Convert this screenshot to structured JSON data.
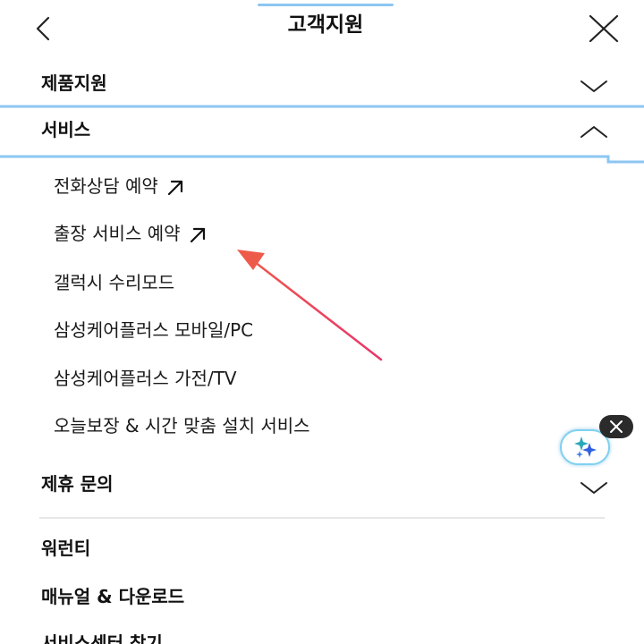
{
  "header": {
    "title": "고객지원",
    "back_icon": "back-chevron-icon",
    "close_icon": "close-icon"
  },
  "sections": [
    {
      "label": "제품지원",
      "state": "collapsed"
    },
    {
      "label": "서비스",
      "state": "expanded"
    },
    {
      "label": "제휴 문의",
      "state": "collapsed"
    }
  ],
  "service_items": [
    {
      "label": "전화상담 예약",
      "external": true
    },
    {
      "label": "출장 서비스 예약",
      "external": true
    },
    {
      "label": "갤럭시 수리모드",
      "external": false
    },
    {
      "label": "삼성케어플러스 모바일/PC",
      "external": false
    },
    {
      "label": "삼성케어플러스 가전/TV",
      "external": false
    },
    {
      "label": "오늘보장 & 시간 맞춤 설치 서비스",
      "external": false
    }
  ],
  "links": [
    {
      "label": "워런티"
    },
    {
      "label": "매뉴얼 & 다운로드"
    },
    {
      "label": "서비스센터 찾기"
    }
  ],
  "colors": {
    "accent_border": "#8cc6f2",
    "annotation_arrow": "#e8475f",
    "fab_ring": "#7fd1f0"
  },
  "floating_button": {
    "icon": "sparkle-icon",
    "dismiss_icon": "close-icon"
  }
}
